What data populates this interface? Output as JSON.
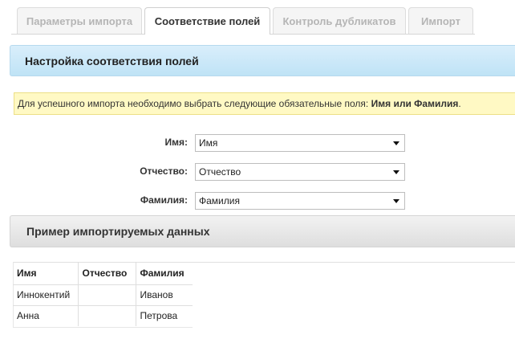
{
  "tabs": [
    {
      "label": "Параметры импорта",
      "active": false
    },
    {
      "label": "Соответствие полей",
      "active": true
    },
    {
      "label": "Контроль дубликатов",
      "active": false
    },
    {
      "label": "Импорт",
      "active": false
    }
  ],
  "mapping_section": {
    "title": "Настройка соответствия полей"
  },
  "notice": {
    "text": "Для успешного импорта необходимо выбрать следующие обязательные поля: ",
    "required_fields": "Имя или Фамилия",
    "suffix": "."
  },
  "fields": [
    {
      "label": "Имя:",
      "value": "Имя"
    },
    {
      "label": "Отчество:",
      "value": "Отчество"
    },
    {
      "label": "Фамилия:",
      "value": "Фамилия"
    }
  ],
  "preview_section": {
    "title": "Пример импортируемых данных"
  },
  "preview_table": {
    "headers": [
      "Имя",
      "Отчество",
      "Фамилия"
    ],
    "rows": [
      [
        "Иннокентий",
        "",
        "Иванов"
      ],
      [
        "Анна",
        "",
        "Петрова"
      ]
    ]
  },
  "colors": {
    "section_blue": "#bfe3f6",
    "notice_bg": "#fff9c4",
    "section_grey": "#dedede"
  }
}
